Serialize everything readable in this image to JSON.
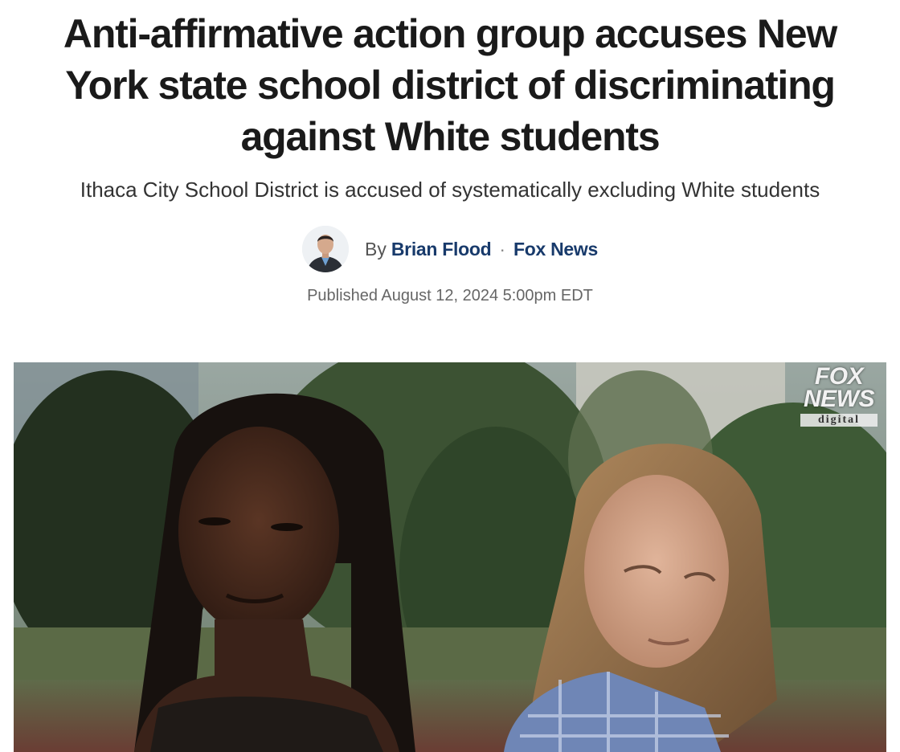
{
  "article": {
    "headline": "Anti-affirmative action group accuses New York state school district of discriminating against White students",
    "subheadline": "Ithaca City School District is accused of systematically excluding White students",
    "byline": {
      "by_label": "By",
      "author": "Brian Flood",
      "separator": "·",
      "outlet": "Fox News"
    },
    "published": "Published August 12, 2024 5:00pm EDT"
  },
  "hero_image": {
    "watermark": {
      "line1": "FOX",
      "line2": "NEWS",
      "line3": "digital"
    }
  },
  "colors": {
    "link_navy": "#183a6b",
    "headline": "#1a1a1a"
  },
  "icons": {
    "author_avatar": "author-avatar-photo",
    "watermark": "fox-news-digital-logo"
  }
}
